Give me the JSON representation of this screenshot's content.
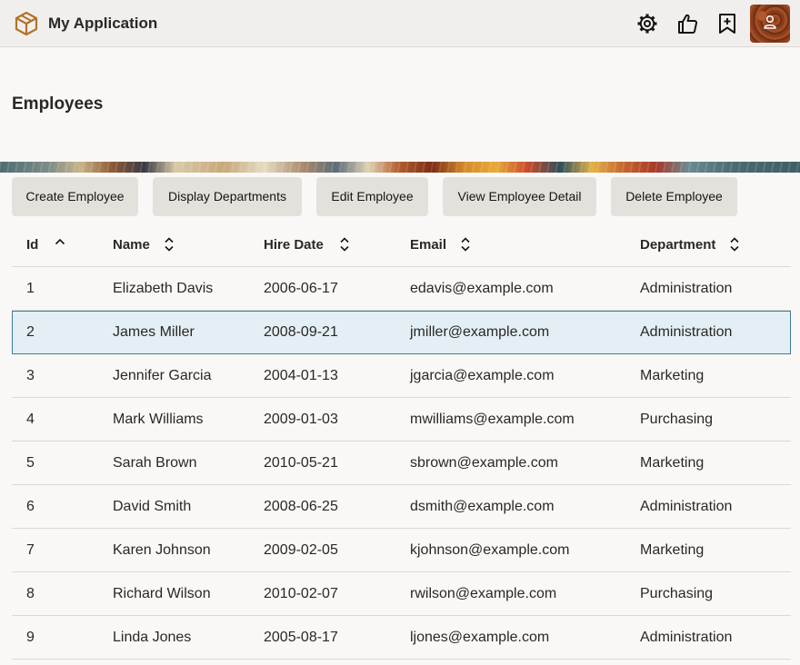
{
  "app": {
    "title": "My Application"
  },
  "page": {
    "title": "Employees"
  },
  "toolbar": {
    "buttons": [
      "Create Employee",
      "Display Departments",
      "Edit Employee",
      "View Employee Detail",
      "Delete Employee"
    ]
  },
  "table": {
    "columns": [
      "Id",
      "Name",
      "Hire Date",
      "Email",
      "Department"
    ],
    "sort": {
      "column": "Id",
      "direction": "ascending"
    },
    "selected_row_id": "2",
    "rows": [
      [
        "1",
        "Elizabeth Davis",
        "2006-06-17",
        "edavis@example.com",
        "Administration"
      ],
      [
        "2",
        "James Miller",
        "2008-09-21",
        "jmiller@example.com",
        "Administration"
      ],
      [
        "3",
        "Jennifer Garcia",
        "2004-01-13",
        "jgarcia@example.com",
        "Marketing"
      ],
      [
        "4",
        "Mark Williams",
        "2009-01-03",
        "mwilliams@example.com",
        "Purchasing"
      ],
      [
        "5",
        "Sarah Brown",
        "2010-05-21",
        "sbrown@example.com",
        "Marketing"
      ],
      [
        "6",
        "David Smith",
        "2008-06-25",
        "dsmith@example.com",
        "Administration"
      ],
      [
        "7",
        "Karen Johnson",
        "2009-02-05",
        "kjohnson@example.com",
        "Marketing"
      ],
      [
        "8",
        "Richard Wilson",
        "2010-02-07",
        "rwilson@example.com",
        "Purchasing"
      ],
      [
        "9",
        "Linda Jones",
        "2005-08-17",
        "ljones@example.com",
        "Administration"
      ]
    ]
  },
  "icons": {
    "logo": "cube-logo-icon",
    "settings": "gear-icon",
    "feedback": "thumbs-up-icon",
    "bookmark": "bookmark-add-icon",
    "user": "user-avatar"
  },
  "colors": {
    "accent": "#3e7d95",
    "selected_row": "#e3eff5",
    "logo": "#b1732a"
  }
}
